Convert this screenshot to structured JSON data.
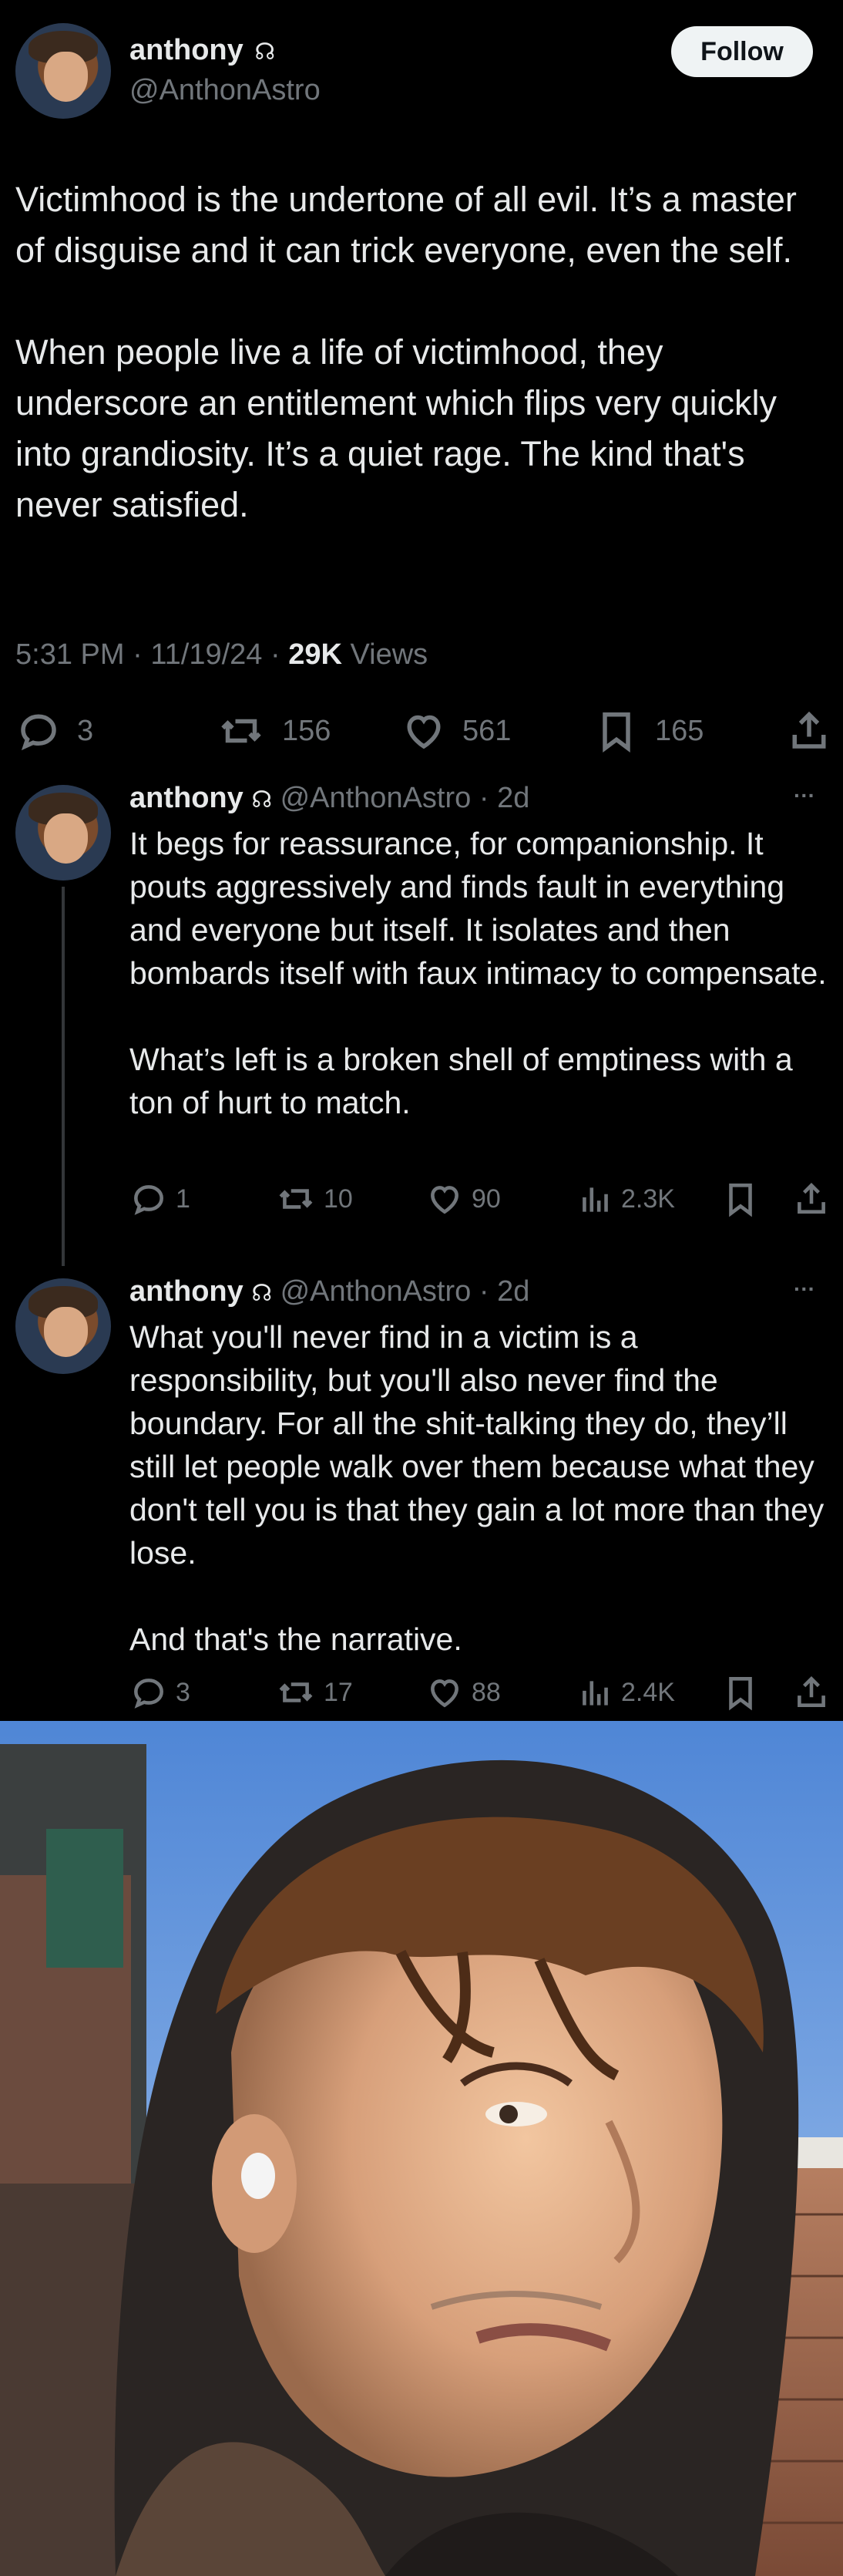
{
  "main_tweet": {
    "display_name": "anthony",
    "name_symbol": "☊",
    "handle": "@AnthonAstro",
    "follow_label": "Follow",
    "text": "Victimhood is the undertone of all evil. It’s a master of disguise and it can trick everyone, even the self.\n\nWhen people live a life of victimhood, they underscore an entitlement which flips very quickly into grandiosity. It’s a quiet rage. The kind that's never satisfied.",
    "time": "5:31 PM",
    "date": "11/19/24",
    "views_count": "29K",
    "views_label": "Views",
    "sep": "·",
    "replies": "3",
    "retweets": "156",
    "likes": "561",
    "bookmarks": "165"
  },
  "replies": [
    {
      "display_name": "anthony",
      "name_symbol": "☊",
      "handle": "@AnthonAstro",
      "age": "2d",
      "sep": "·",
      "more": "···",
      "text": "It begs for reassurance, for companionship. It pouts aggressively and finds fault in everything and everyone but itself. It isolates and then bombards itself with faux intimacy to compensate.\n\nWhat’s left is a broken shell of emptiness with a ton of hurt to match.",
      "replies": "1",
      "retweets": "10",
      "likes": "90",
      "views": "2.3K"
    },
    {
      "display_name": "anthony",
      "name_symbol": "☊",
      "handle": "@AnthonAstro",
      "age": "2d",
      "sep": "·",
      "more": "···",
      "text": "What you'll never find in a victim is a responsibility, but you'll also never find the boundary. For all the shit-talking they do, they’ll still let people walk over them because what they don't tell you is that they gain a lot more than they lose.\n\nAnd that's the narrative.",
      "replies": "3",
      "retweets": "17",
      "likes": "88",
      "views": "2.4K"
    }
  ],
  "icons": [
    "reply-icon",
    "retweet-icon",
    "like-icon",
    "bookmark-icon",
    "share-icon",
    "views-icon",
    "more-icon"
  ]
}
